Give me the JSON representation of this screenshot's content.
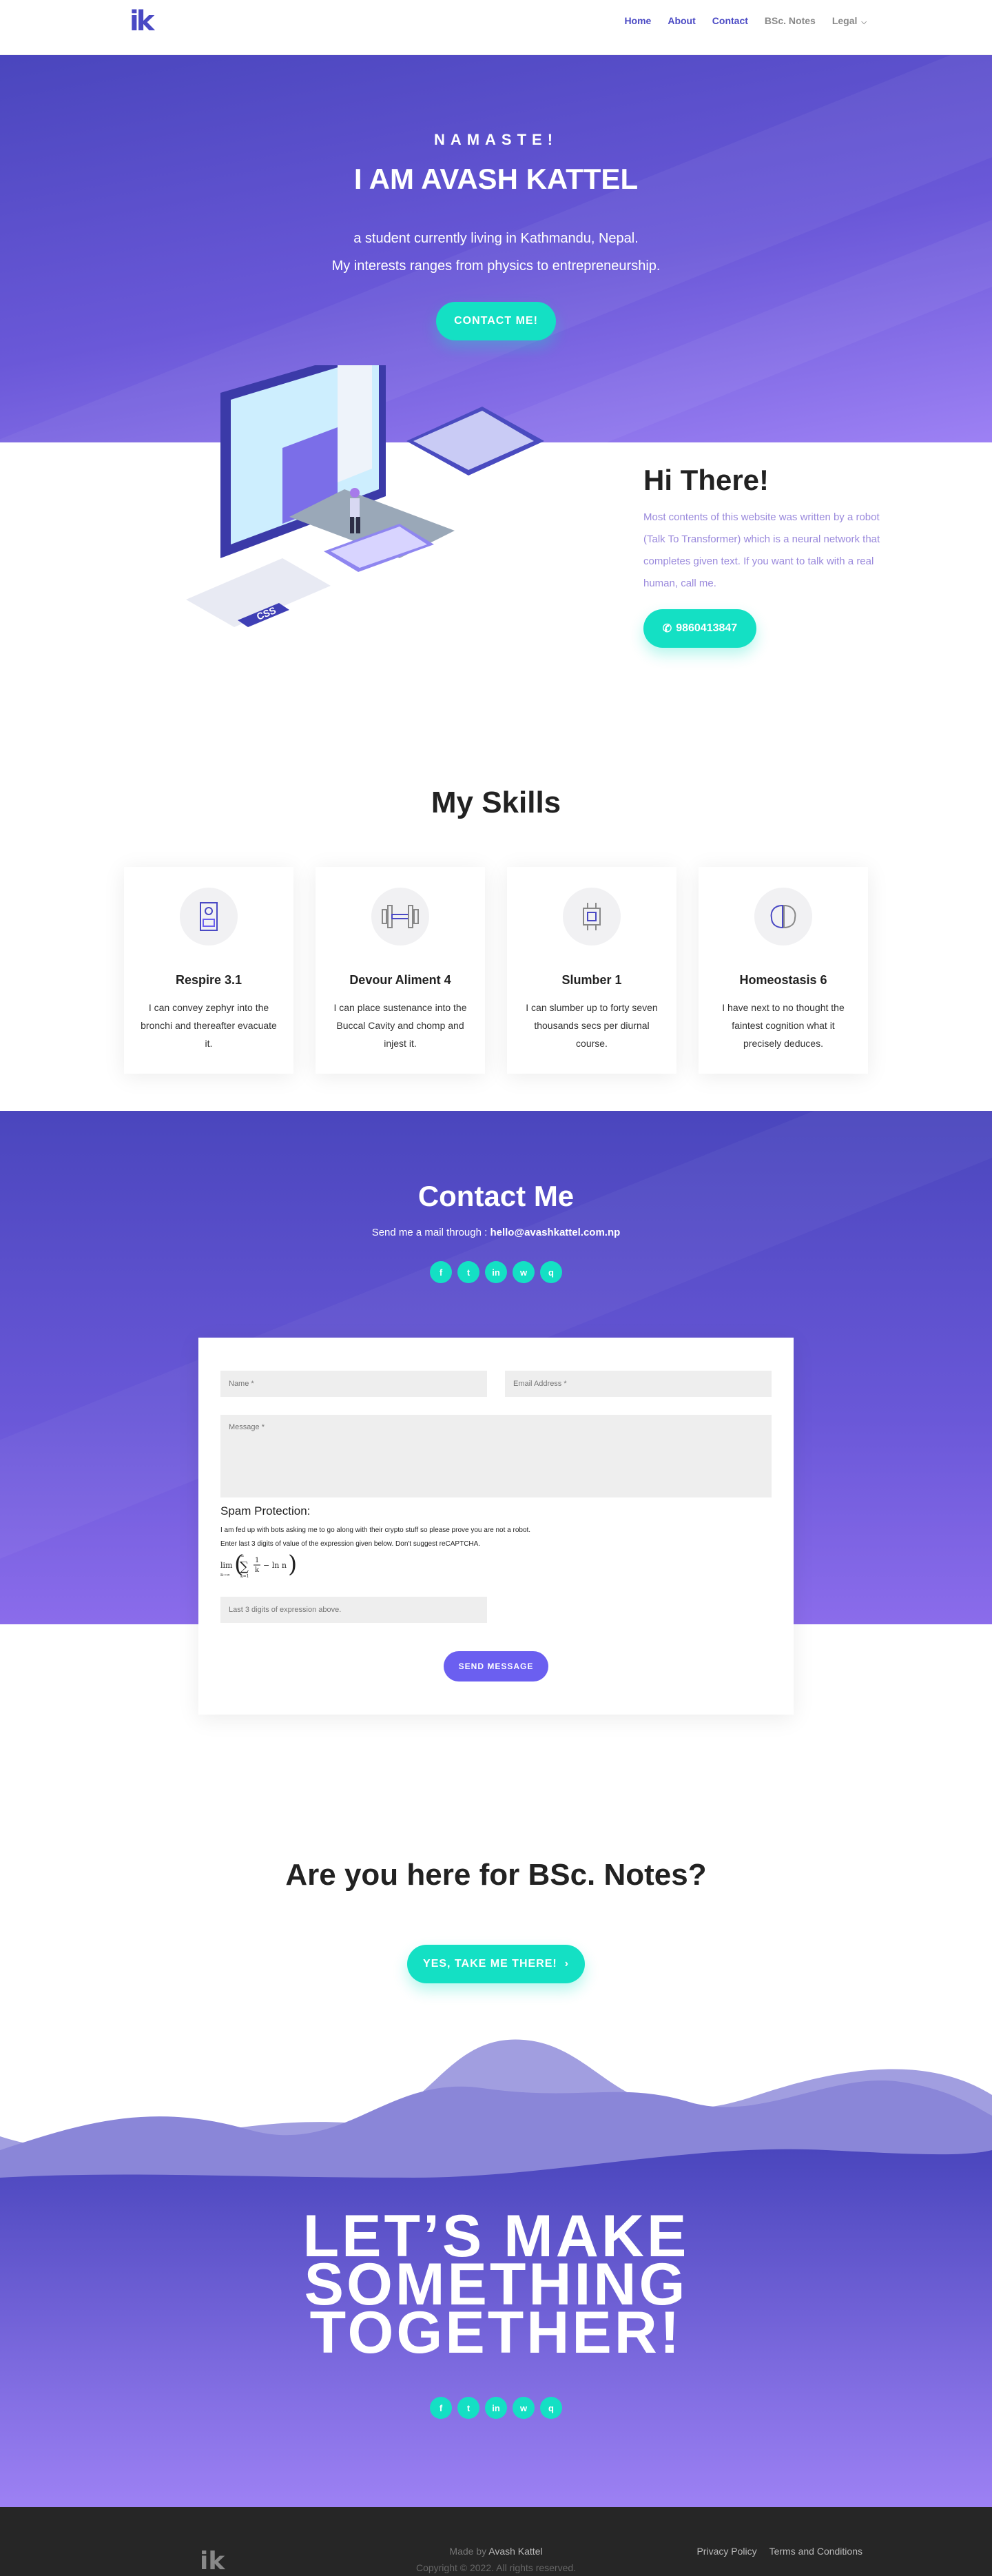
{
  "nav": {
    "logo": "ik",
    "items": [
      {
        "label": "Home",
        "active": true
      },
      {
        "label": "About",
        "active": true
      },
      {
        "label": "Contact",
        "active": true
      },
      {
        "label": "BSc. Notes",
        "active": false
      },
      {
        "label": "Legal",
        "active": false
      }
    ]
  },
  "hero": {
    "greeting": "NAMASTE!",
    "title": "I AM AVASH KATTEL",
    "line1": "a student currently living in Kathmandu, Nepal.",
    "line2": "My interests ranges from physics to entrepreneurship.",
    "cta": "CONTACT ME!"
  },
  "illustration": {
    "tag": "CSS"
  },
  "intro": {
    "title": "Hi There!",
    "description": "Most contents of this website was written by a robot (Talk To Transformer) which is a neural network that completes given text. If you want to talk with a real human, call me.",
    "phone": "9860413847"
  },
  "skills": {
    "title": "My Skills",
    "cards": [
      {
        "title": "Respire 3.1",
        "text": "I can convey zephyr into the bronchi and thereafter evacuate it.",
        "icon": "lungs-icon"
      },
      {
        "title": "Devour Aliment 4",
        "text": "I can place sustenance into the Buccal Cavity and chomp and injest it.",
        "icon": "dumbbell-icon"
      },
      {
        "title": "Slumber 1",
        "text": "I can slumber up to forty seven thousands secs per diurnal course.",
        "icon": "chip-icon"
      },
      {
        "title": "Homeostasis 6",
        "text": "I have next to no thought the faintest cognition what it precisely deduces.",
        "icon": "brain-icon"
      }
    ]
  },
  "contact": {
    "title": "Contact Me",
    "sub_prefix": "Send me a mail through :",
    "email": "hello@avashkattel.com.np",
    "form": {
      "name_placeholder": "Name *",
      "email_placeholder": "Email Address *",
      "message_placeholder": "Message *",
      "spam_title": "Spam Protection:",
      "spam_line1": "I am fed up with bots asking me to go along with their crypto stuff so please prove you are not a robot.",
      "spam_line2": "Enter last 3 digits of value of the expression given below. Don't suggest reCAPTCHA.",
      "answer_placeholder": "Last 3 digits of expression above.",
      "send": "SEND MESSAGE"
    }
  },
  "bsc": {
    "title": "Are you here for BSc. Notes?",
    "button": "YES, TAKE ME THERE!"
  },
  "together": {
    "line1": "LET’S MAKE",
    "line2": "SOMETHING",
    "line3": "TOGETHER!"
  },
  "socials": [
    "f",
    "t",
    "in",
    "w",
    "q"
  ],
  "footer": {
    "made_by_prefix": "Made by",
    "made_by_name": "Avash Kattel",
    "copyright": "Copyright © 2022. All rights reserved.",
    "privacy": "Privacy Policy",
    "terms": "Terms and Conditions"
  },
  "colors": {
    "accent": "#14e0c4",
    "brand": "#4a49c4",
    "purple_light": "#9d81f4"
  }
}
